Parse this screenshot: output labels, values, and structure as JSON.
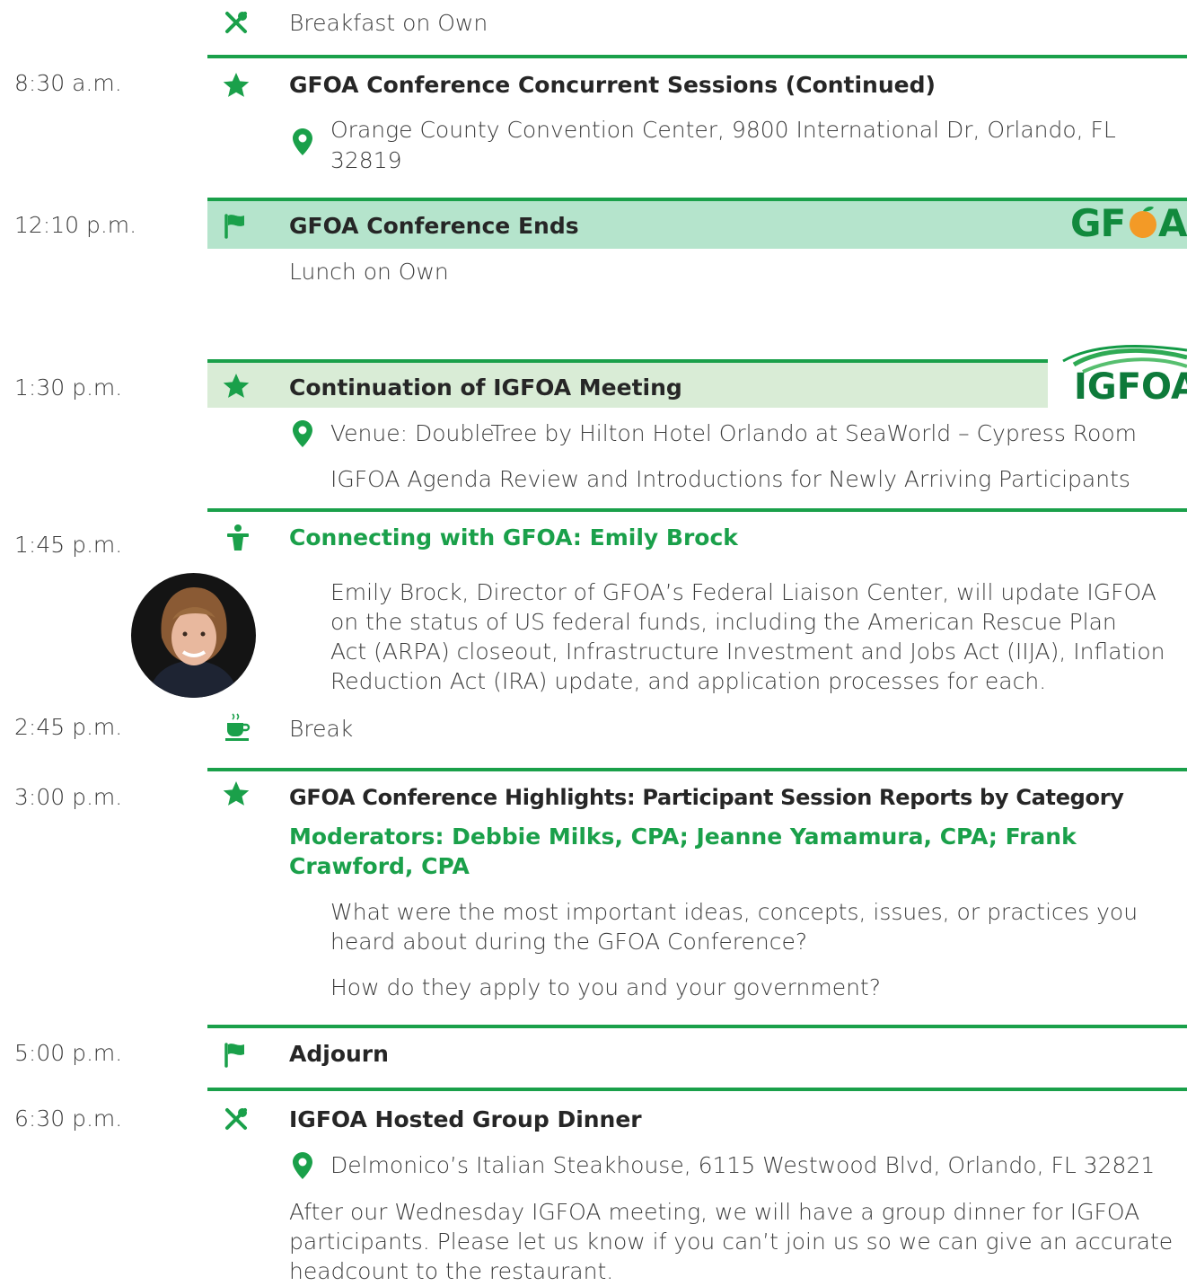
{
  "colors": {
    "accent": "#1aa04a",
    "band_gfoa": "#b5e4cc",
    "band_igfoa": "#d9ecd6",
    "text": "#3d3d3d"
  },
  "row_breakfast": {
    "icon": "utensils-icon",
    "title": "Breakfast on Own"
  },
  "row_830": {
    "time": "8:30 a.m.",
    "icon": "star-icon",
    "title": "GFOA Conference Concurrent Sessions (Continued)",
    "location_icon": "map-pin-icon",
    "location_line1": "Orange County Convention Center, 9800 International Dr, Orlando, FL",
    "location_line2": "32819"
  },
  "row_1210": {
    "time": "12:10 p.m.",
    "icon": "flag-icon",
    "title": "GFOA Conference Ends",
    "logo": "GFOA",
    "note": "Lunch on Own"
  },
  "row_130": {
    "time": "1:30 p.m.",
    "icon": "star-icon",
    "title": "Continuation of IGFOA Meeting",
    "logo": "IGFOA",
    "location": "Venue: DoubleTree by Hilton Hotel Orlando at SeaWorld – Cypress Room",
    "detail": "IGFOA Agenda Review and Introductions for Newly Arriving Participants"
  },
  "row_145": {
    "time": "1:45 p.m.",
    "icon": "speaker-icon",
    "title": "Connecting with GFOA: Emily Brock",
    "desc_lines": [
      "Emily Brock, Director of GFOA’s Federal Liaison Center, will update IGFOA",
      "on the status of US federal funds, including the American Rescue Plan",
      "Act (ARPA) closeout, Infrastructure Investment and Jobs Act (IIJA), Inflation",
      "Reduction Act (IRA) update, and application processes for each."
    ]
  },
  "row_245": {
    "time": "2:45 p.m.",
    "icon": "coffee-icon",
    "title": "Break"
  },
  "row_300": {
    "time": "3:00 p.m.",
    "icon": "star-icon",
    "title": "GFOA Conference Highlights: Participant Session Reports by Category",
    "moderators_line1": "Moderators: Debbie Milks, CPA; Jeanne Yamamura, CPA; Frank",
    "moderators_line2": "Crawford, CPA",
    "q1_line1": "What were the most important ideas, concepts, issues, or practices you",
    "q1_line2": "heard about during the GFOA Conference?",
    "q2": "How do they apply to you and your government?"
  },
  "row_500": {
    "time": "5:00 p.m.",
    "icon": "flag-icon",
    "title": "Adjourn"
  },
  "row_630": {
    "time": "6:30 p.m.",
    "icon": "utensils-icon",
    "title": "IGFOA Hosted Group Dinner",
    "location": "Delmonico’s Italian Steakhouse, 6115 Westwood Blvd, Orlando, FL 32821",
    "desc_lines": [
      "After our Wednesday IGFOA meeting, we will have a group dinner for IGFOA",
      "participants.  Please let us know if you can’t join us so we can give an accurate",
      "headcount to the restaurant."
    ]
  }
}
